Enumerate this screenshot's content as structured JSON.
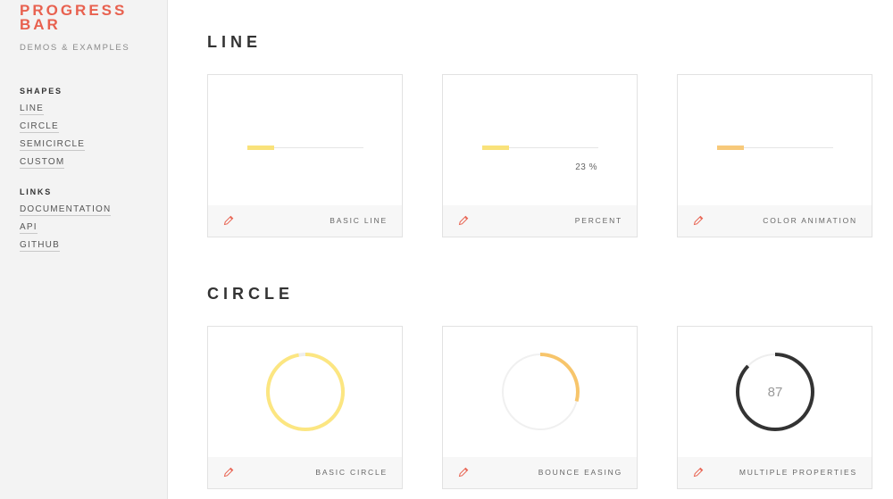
{
  "sidebar": {
    "brand": "PROGRESS BAR",
    "tagline": "DEMOS & EXAMPLES",
    "shapes_heading": "SHAPES",
    "shapes": [
      "LINE",
      "CIRCLE",
      "SEMICIRCLE",
      "CUSTOM"
    ],
    "links_heading": "LINKS",
    "links": [
      "DOCUMENTATION",
      "API",
      "GITHUB"
    ]
  },
  "sections": {
    "line": {
      "title": "LINE",
      "cards": [
        {
          "label": "BASIC LINE",
          "progress": 0.23,
          "color": "#f9e27a"
        },
        {
          "label": "PERCENT",
          "progress": 0.23,
          "color": "#f9e27a",
          "text": "23 %"
        },
        {
          "label": "COLOR ANIMATION",
          "progress": 0.23,
          "color": "#f7c97a"
        }
      ]
    },
    "circle": {
      "title": "CIRCLE",
      "cards": [
        {
          "label": "BASIC CIRCLE",
          "progress": 0.97,
          "color": "#fce681",
          "trail": "#eeeeee"
        },
        {
          "label": "BOUNCE EASING",
          "progress": 0.29,
          "color": "#f7c56b",
          "trail": "#f0f0f0"
        },
        {
          "label": "MULTIPLE PROPERTIES",
          "progress": 0.87,
          "color": "#333333",
          "trail": "#eeeeee",
          "text": "87"
        }
      ]
    }
  },
  "colors": {
    "brand": "#e8614f",
    "edit_icon": "#e8614f"
  },
  "icons": {
    "edit": "pencil-icon"
  }
}
